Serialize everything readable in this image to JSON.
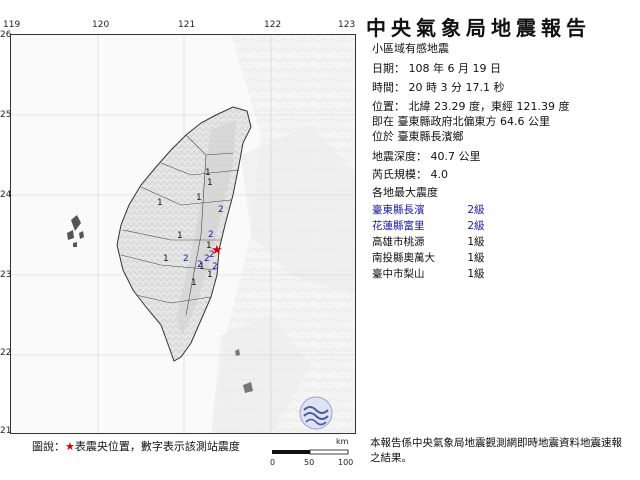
{
  "header": {
    "title": "中央氣象局地震報告",
    "subtitle": "小區域有感地震"
  },
  "report": {
    "date": "日期： 108 年 6 月 19 日",
    "time": "時間： 20 時 3 分 17.1 秒",
    "position_line1": "位置：  北緯 23.29 度，東經 121.39 度",
    "position_line2": "即在 臺東縣政府北偏東方 64.6 公里",
    "position_line3": "位於 臺東縣長濱鄉",
    "depth": "地震深度： 40.7 公里",
    "magnitude": "芮氏規模： 4.0",
    "intensity_heading": "各地最大震度"
  },
  "intensity_list": [
    {
      "station": "臺東縣長濱",
      "level": "2級",
      "color": "#1a1aa8"
    },
    {
      "station": "花蓮縣富里",
      "level": "2級",
      "color": "#1a1aa8"
    },
    {
      "station": "高雄市桃源",
      "level": "1級",
      "color": "#111111"
    },
    {
      "station": "南投縣奧萬大",
      "level": "1級",
      "color": "#111111"
    },
    {
      "station": "臺中市梨山",
      "level": "1級",
      "color": "#111111"
    }
  ],
  "map": {
    "lon_ticks": [
      "119",
      "120",
      "121",
      "122",
      "123"
    ],
    "lat_ticks": [
      "26",
      "25",
      "24",
      "23",
      "22",
      "21"
    ],
    "epicenter_symbol": "★",
    "epicenter_color": "#dd0000",
    "station_intensities": [
      "1",
      "1",
      "1",
      "1",
      "2",
      "2",
      "1",
      "1",
      "1",
      "2",
      "2",
      "2",
      "2",
      "1",
      "1",
      "2",
      "1"
    ],
    "logo_icon": "cwb-logo-icon"
  },
  "legend": {
    "text_prefix": "圖說：",
    "star": "★",
    "text_suffix": "表震央位置，數字表示該測站震度"
  },
  "scale": {
    "unit": "km",
    "labels": [
      "0",
      "50",
      "100"
    ]
  },
  "footer": {
    "note": "本報告係中央氣象局地震觀測網即時地震資料地震速報之結果。"
  }
}
